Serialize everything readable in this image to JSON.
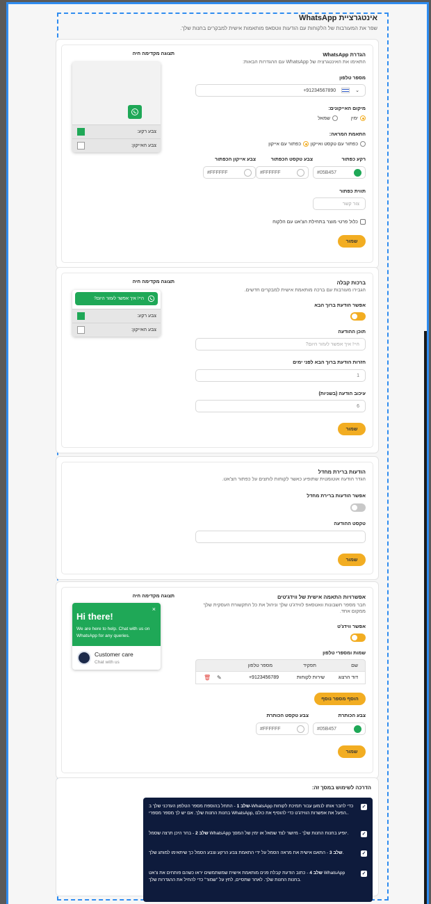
{
  "page": {
    "title": "אינטגרציית WhatsApp",
    "subtitle": "שפר את המעורבות של הלקוחות עם הודעות ווטסאפ מותאמות אישית למבקרים בחנות שלך."
  },
  "colors": {
    "accent": "#f2ad22",
    "green": "#1fa857",
    "frame": "#2f8cf0",
    "guide_bg": "#0e1b3c"
  },
  "setup": {
    "title": "הגדרת WhatsApp",
    "subtitle": "התאימו את האינטגרציה של WhatsApp עם ההגדרות הבאות:",
    "phone_label": "מספר טלפון",
    "phone_value": "+91234567890",
    "country_flag": "israel-flag",
    "icon_position_label": "מיקום האייקונים:",
    "position_right": "ימין",
    "position_left": "שמאל",
    "position_selected": "right",
    "appearance_label": "התאמת המראה:",
    "appearance_text_icon": "כפתור עם טקסט ואייקון",
    "appearance_icon": "כפתור עם אייקון",
    "appearance_selected": "icon",
    "btn_bg_label": "רקע כפתור",
    "btn_bg_value": "#05B457",
    "btn_text_label": "צבע טקסט הכפתור",
    "btn_text_value": "#FFFFFF",
    "btn_icon_label": "צבע אייקון הכפתור",
    "btn_icon_value": "#FFFFFF",
    "shape_label": "תווית כפתור",
    "shape_placeholder": "צור קשר",
    "include_label": "כלול פרטי מוצר בתחילת הצ'אט עם הלקוח",
    "save": "שמור",
    "preview_title": "תצוגה מקדימה חיה",
    "preview_bg_label": "צבע רקע:",
    "preview_icon_label": "צבע האייקון:"
  },
  "welcome": {
    "title": "ברכות קבלה",
    "subtitle": "הגבירו מעורבות עם ברכה מותאמת אישית למבקרים חדשים.",
    "enable_label": "אפשר הודעת ברוך הבא",
    "content_label": "תוכן ההודעה",
    "content_placeholder": "היי! איך אפשר לעזור היום?",
    "repeat_label": "חזרות הודעת ברוך הבא לפני ימים",
    "repeat_value": "1",
    "delay_label": "עיכוב הודעה (בשניות)",
    "delay_value": "6",
    "save": "שמור",
    "preview_title": "תצוגה מקדימה חיה",
    "bubble_text": "היי! איך אפשר לעזור היום?",
    "preview_bg_label": "צבע רקע:",
    "preview_icon_label": "צבע האייקון:"
  },
  "default_msg": {
    "title": "הודעות ברירת מחדל",
    "subtitle": "הגדר הודעה אוטומטית שתופיע כאשר לקוחות לוחצים על כפתור הצ'אט.",
    "enable_label": "אפשר הודעות ברירת מחדל",
    "text_label": "טקסט ההודעה",
    "save": "שמור"
  },
  "widget": {
    "title": "אפשרויות התאמה אישית של ווידג'טים",
    "subtitle": "חבר מספר חשבונות וואטסאפ לווידג'ט שלך וניהול את כל התקשורת העסקית שלך ממקום אחד.",
    "enable_label": "אפשר ווידג'ט",
    "names_label": "שמות ומספרי טלפון",
    "col_name": "שם",
    "col_role": "תפקיד",
    "col_phone": "מספר טלפון",
    "rows": [
      {
        "name": "דוד הרצוג",
        "role": "שירות לקוחות",
        "phone": "+9123456789"
      }
    ],
    "add_button": "הוסף מספר נוסף",
    "title_color_label": "צבע הכותרת",
    "title_color_value": "#05B457",
    "title_text_color_label": "צבע טקסט הכותרת",
    "title_text_color_value": "#FFFFFF",
    "save": "שמור",
    "preview_title": "תצוגה מקדימה חיה",
    "hi": "Hi there!",
    "help": "We are here to help. Chat with us on WhatsApp for any queries.",
    "agent": "Customer care",
    "agent_sub": "Chat with us"
  },
  "guide": {
    "title": "הדרכה לשימוש במסך זה:",
    "steps": [
      {
        "bold": "שלב 1",
        "text": " - התחל בהוספת מספר הטלפון העדכני שלך ב-WhatsApp כדי לחבר אותו לנמען עבור תמיכת לקוחות בחנות החנות שלך. אם יש לך מספר מספרי WhatsApp, הפעל את אפשרות הווידג'ט כדי להוסיף את כולם.."
      },
      {
        "bold": "שלב 2",
        "text": " - בחר היכן תרצה שסמל WhatsApp יופיע בחנות החנות שלך - מיושר לצד שמאל או ימין של המסך."
      },
      {
        "bold": "שלב 3",
        "text": " - התאם אישית את מראה הסמל על ידי התאמת צבע הרקע וצבע הסמל כך שיתאימו למותג שלך."
      },
      {
        "bold": "שלב 4",
        "text": " - כתוב הודעת קבלת פנים מותאמת אישית שמשתמשים יראו כשהם פותחים את צ'אט WhatsApp בחנות החנות שלך. לאחר שתסיים, לחץ על \"שמור\" כדי להחיל את ההגדרות שלך."
      }
    ]
  }
}
